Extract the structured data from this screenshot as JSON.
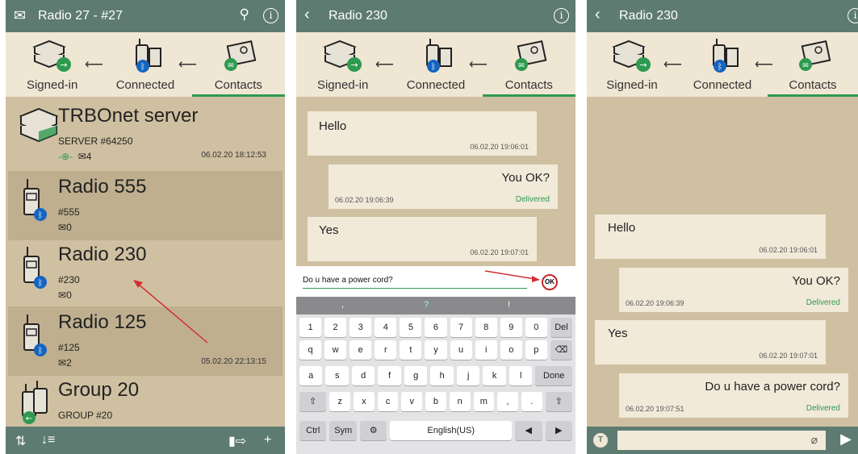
{
  "tabs": [
    "Signed-in",
    "Connected",
    "Contacts"
  ],
  "screen1": {
    "title": "Radio 27 - #27",
    "items": [
      {
        "name": "TRBOnet server",
        "sub": "SERVER #64250",
        "count": "4",
        "ts": "06.02.20 18:12:53"
      },
      {
        "name": "Radio 555",
        "sub": "#555",
        "count": "0",
        "ts": ""
      },
      {
        "name": "Radio 230",
        "sub": "#230",
        "count": "0",
        "ts": ""
      },
      {
        "name": "Radio 125",
        "sub": "#125",
        "count": "2",
        "ts": "05.02.20 22:13:15"
      },
      {
        "name": "Group 20",
        "sub": "GROUP #20",
        "count": "",
        "ts": ""
      }
    ]
  },
  "screen2": {
    "title": "Radio 230",
    "messages": [
      {
        "text": "Hello",
        "ts": "06.02.20 19:06:01"
      },
      {
        "text": "You OK?",
        "ts": "06.02.20 19:06:39",
        "status": "Delivered"
      },
      {
        "text": "Yes",
        "ts": "06.02.20 19:07:01"
      }
    ],
    "input_value": "Do u have a power cord?",
    "ok_label": "OK",
    "keyboard": {
      "suggestions": [
        ",",
        "?",
        "!"
      ],
      "row1": [
        "1",
        "2",
        "3",
        "4",
        "5",
        "6",
        "7",
        "8",
        "9",
        "0",
        "Del"
      ],
      "row2": [
        "q",
        "w",
        "e",
        "r",
        "t",
        "y",
        "u",
        "i",
        "o",
        "p",
        "⌫"
      ],
      "row3": [
        "a",
        "s",
        "d",
        "f",
        "g",
        "h",
        "j",
        "k",
        "l",
        "Done"
      ],
      "row4": [
        "⇧",
        "z",
        "x",
        "c",
        "v",
        "b",
        "n",
        "m",
        ",",
        ".",
        "⇧"
      ],
      "row5": [
        "Ctrl",
        "Sym",
        "⚙",
        "English(US)",
        "◀",
        "▶"
      ]
    }
  },
  "screen3": {
    "title": "Radio 230",
    "messages": [
      {
        "text": "Hello",
        "ts": "06.02.20 19:06:01"
      },
      {
        "text": "You OK?",
        "ts": "06.02.20 19:06:39",
        "status": "Delivered"
      },
      {
        "text": "Yes",
        "ts": "06.02.20 19:07:01"
      },
      {
        "text": "Do u have a power cord?",
        "ts": "06.02.20 19:07:51",
        "status": "Delivered"
      }
    ],
    "composer_btn": "T"
  },
  "colors": {
    "accent": "#2e9a4f",
    "bar": "#5e7b71",
    "bg": "#cfc0a1",
    "annotation": "#d32f2f"
  }
}
